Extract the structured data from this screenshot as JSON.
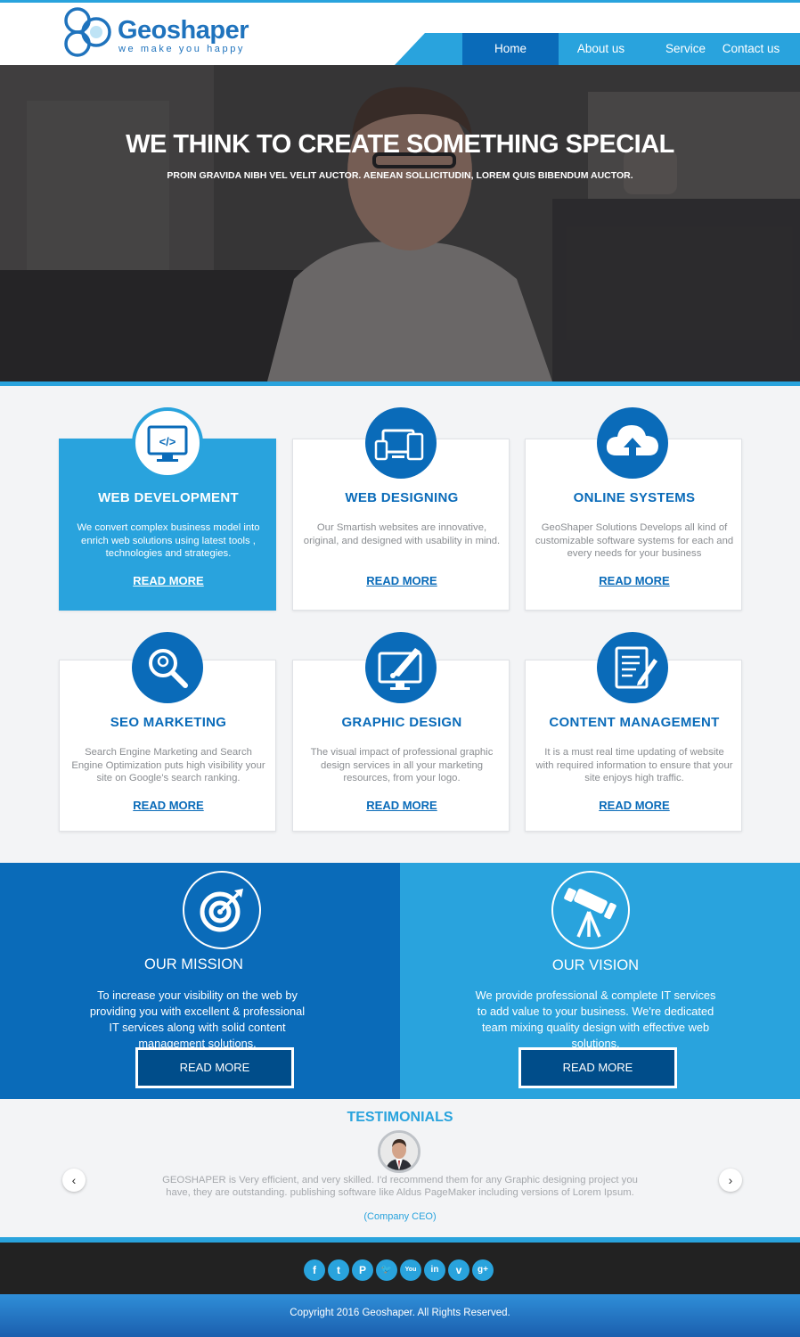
{
  "brand": {
    "name": "Geoshaper",
    "tagline": "we make you happy"
  },
  "nav": {
    "items": [
      {
        "label": "Home",
        "active": true
      },
      {
        "label": "About us",
        "active": false
      },
      {
        "label": "Service",
        "active": false
      },
      {
        "label": "Contact us",
        "active": false
      }
    ]
  },
  "hero": {
    "title": "WE THINK TO CREATE SOMETHING SPECIAL",
    "subtitle": "PROIN GRAVIDA NIBH VEL VELIT AUCTOR. AENEAN SOLLICITUDIN, LOREM QUIS BIBENDUM AUCTOR."
  },
  "services": [
    {
      "title": "WEB DEVELOPMENT",
      "text": "We convert complex business model into enrich web solutions using latest tools , technologies and strategies.",
      "link": "READ MORE",
      "icon": "code-monitor-icon",
      "active": true
    },
    {
      "title": "WEB DESIGNING",
      "text": "Our Smartish websites are innovative, original, and designed with usability in mind.",
      "link": "READ MORE",
      "icon": "devices-icon",
      "active": false
    },
    {
      "title": "ONLINE SYSTEMS",
      "text": "GeoShaper Solutions Develops all kind of customizable software systems for each and every needs for your business",
      "link": "READ MORE",
      "icon": "cloud-upload-icon",
      "active": false
    },
    {
      "title": "SEO MARKETING",
      "text": "Search Engine Marketing and Search Engine Optimization puts high visibility your site on Google's search ranking.",
      "link": "READ MORE",
      "icon": "search-icon",
      "active": false
    },
    {
      "title": "GRAPHIC DESIGN",
      "text": "The visual impact of professional graphic design services in all your marketing resources, from your logo.",
      "link": "READ MORE",
      "icon": "monitor-brush-icon",
      "active": false
    },
    {
      "title": "CONTENT MANAGEMENT",
      "text": "It is a must real time updating of website with required information to ensure that your site enjoys high traffic.",
      "link": "READ MORE",
      "icon": "document-edit-icon",
      "active": false
    }
  ],
  "mission": {
    "title": "OUR MISSION",
    "text": "To increase your visibility on the web by providing you with excellent & professional IT services along with solid content management solutions.",
    "button": "READ MORE",
    "icon": "target-icon"
  },
  "vision": {
    "title": "OUR VISION",
    "text": "We provide professional & complete IT services to add value to your business. We're dedicated team mixing quality design with effective web solutions.",
    "button": "READ MORE",
    "icon": "telescope-icon"
  },
  "testimonials": {
    "title": "TESTIMONIALS",
    "quote": "GEOSHAPER is Very efficient, and very skilled. I'd recommend them for any Graphic designing project you have, they are outstanding. publishing software like Aldus PageMaker including versions of Lorem Ipsum.",
    "author": "(Company CEO)"
  },
  "social": [
    {
      "icon": "facebook-icon",
      "glyph": "f"
    },
    {
      "icon": "tumblr-icon",
      "glyph": "t"
    },
    {
      "icon": "pinterest-icon",
      "glyph": "P"
    },
    {
      "icon": "twitter-icon",
      "glyph": "🐦"
    },
    {
      "icon": "youtube-icon",
      "glyph": "You"
    },
    {
      "icon": "linkedin-icon",
      "glyph": "in"
    },
    {
      "icon": "vimeo-icon",
      "glyph": "v"
    },
    {
      "icon": "googleplus-icon",
      "glyph": "g+"
    }
  ],
  "footer": {
    "copyright": "Copyright 2016 Geoshaper. All Rights Reserved."
  },
  "colors": {
    "primary": "#0a6bb9",
    "accent": "#29a3dd",
    "footer": "#222222"
  }
}
